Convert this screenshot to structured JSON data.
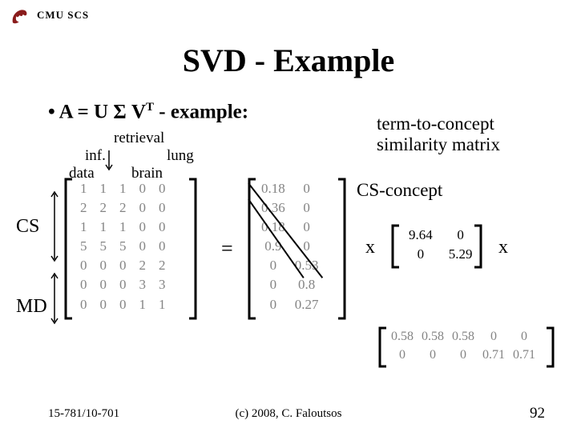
{
  "header": {
    "org": "CMU SCS"
  },
  "title": "SVD - Example",
  "bullet": {
    "pre": "•  A = U ",
    "sigma": "Σ",
    "vt_base": " V",
    "vt_sup": "T",
    "post": " - example:"
  },
  "cols": {
    "retrieval": "retrieval",
    "inf": "inf.",
    "lung": "lung",
    "data": "data",
    "brain": "brain"
  },
  "annot": {
    "ttc_l1": "term-to-concept",
    "ttc_l2": "similarity matrix",
    "cs_concept": "CS-concept"
  },
  "rowlabels": {
    "cs": "CS",
    "md": "MD"
  },
  "ops": {
    "eq": "=",
    "times": "x"
  },
  "footer": {
    "left": "15-781/10-701",
    "center": "(c) 2008, C. Faloutsos",
    "right": "92"
  },
  "chart_data": {
    "type": "table",
    "title": "SVD - Example",
    "A": [
      [
        1,
        1,
        1,
        0,
        0
      ],
      [
        2,
        2,
        2,
        0,
        0
      ],
      [
        1,
        1,
        1,
        0,
        0
      ],
      [
        5,
        5,
        5,
        0,
        0
      ],
      [
        0,
        0,
        0,
        2,
        2
      ],
      [
        0,
        0,
        0,
        3,
        3
      ],
      [
        0,
        0,
        0,
        1,
        1
      ]
    ],
    "U": [
      [
        0.18,
        0
      ],
      [
        0.36,
        0
      ],
      [
        0.18,
        0
      ],
      [
        0.9,
        0
      ],
      [
        0,
        0.53
      ],
      [
        0,
        0.8
      ],
      [
        0,
        0.27
      ]
    ],
    "S": [
      [
        9.64,
        0
      ],
      [
        0,
        5.29
      ]
    ],
    "VT": [
      [
        0.58,
        0.58,
        0.58,
        0,
        0
      ],
      [
        0,
        0,
        0,
        0.71,
        0.71
      ]
    ],
    "A_row_groups": {
      "CS": [
        0,
        1,
        2,
        3
      ],
      "MD": [
        4,
        5,
        6
      ]
    },
    "A_col_labels": [
      "data",
      "inf.",
      "retrieval",
      "brain",
      "lung"
    ]
  }
}
